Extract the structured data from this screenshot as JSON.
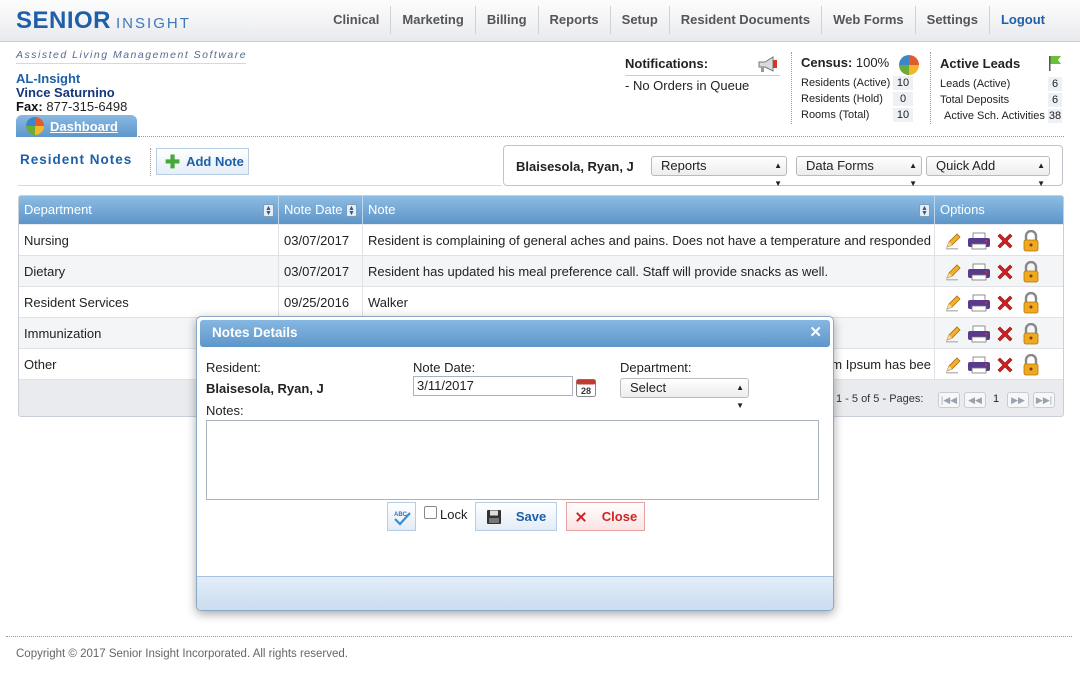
{
  "logo": {
    "senior": "SENIOR",
    "insight": "INSIGHT"
  },
  "nav": [
    "Clinical",
    "Marketing",
    "Billing",
    "Reports",
    "Setup",
    "Resident Documents",
    "Web Forms",
    "Settings",
    "Logout"
  ],
  "tagline": "Assisted Living Management Software",
  "facility": {
    "name": "AL-Insight",
    "user": "Vince Saturnino",
    "fax_label": "Fax:",
    "fax": "877-315-6498"
  },
  "dashboard_tab": "Dashboard",
  "notifications": {
    "title": "Notifications:",
    "message": "- No Orders in Queue"
  },
  "census": {
    "title": "Census:",
    "percent": "100%",
    "rows": [
      {
        "label": "Residents (Active)",
        "value": "10"
      },
      {
        "label": "Residents (Hold)",
        "value": "0"
      },
      {
        "label": "Rooms (Total)",
        "value": "10"
      }
    ]
  },
  "leads": {
    "title": "Active Leads",
    "rows": [
      {
        "label": "Leads (Active)",
        "value": "6"
      },
      {
        "label": "Total Deposits",
        "value": "6"
      },
      {
        "label": "Active Sch. Activities",
        "value": "38"
      }
    ]
  },
  "section": {
    "title": "Resident Notes",
    "add_label": "Add Note"
  },
  "resident_bar": {
    "name": "Blaisesola, Ryan, J",
    "reports": "Reports",
    "data_forms": "Data Forms",
    "quick_add": "Quick Add"
  },
  "table": {
    "headers": {
      "department": "Department",
      "note_date": "Note Date",
      "note": "Note",
      "options": "Options"
    },
    "rows": [
      {
        "department": "Nursing",
        "date": "03/07/2017",
        "note": "Resident is complaining of general aches and pains.  Does not have a temperature and responded"
      },
      {
        "department": "Dietary",
        "date": "03/07/2017",
        "note": "Resident has updated his meal preference call.  Staff will provide snacks as well."
      },
      {
        "department": "Resident Services",
        "date": "09/25/2016",
        "note": "Walker"
      },
      {
        "department": "Immunization",
        "date": "",
        "note": ""
      },
      {
        "department": "Other",
        "date": "",
        "note": "m Ipsum has bee"
      }
    ],
    "pager": {
      "summary": "1 - 5 of 5 - Pages:",
      "current": "1"
    }
  },
  "modal": {
    "title": "Notes Details",
    "resident_label": "Resident:",
    "resident_name": "Blaisesola, Ryan, J",
    "date_label": "Note Date:",
    "date_value": "3/11/2017",
    "calendar_day": "28",
    "department_label": "Department:",
    "department_value": "Select",
    "notes_label": "Notes:",
    "lock_label": "Lock",
    "save_label": "Save",
    "close_label": "Close"
  },
  "footer": "Copyright © 2017 Senior Insight Incorporated. All rights reserved."
}
